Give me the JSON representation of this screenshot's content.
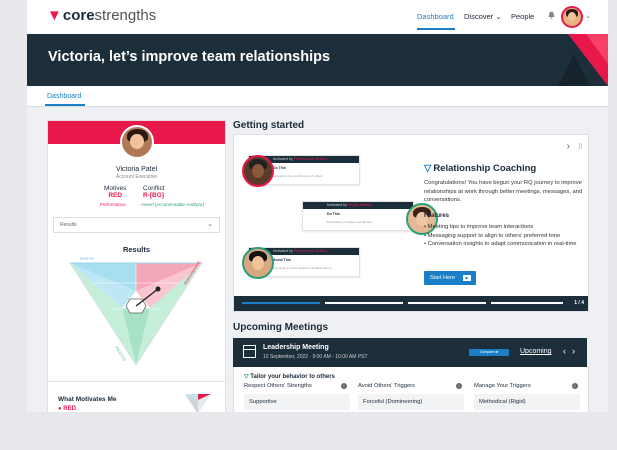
{
  "brand": {
    "logo_bold": "core",
    "logo_thin": "strengths",
    "accent": "#e8194a",
    "blue": "#1a7fc7",
    "navy": "#1d2e3b"
  },
  "nav": {
    "dashboard": "Dashboard",
    "discover": "Discover ⌄",
    "people": "People",
    "bell_icon": "bell-icon",
    "menu_chevron": "⌄"
  },
  "banner": {
    "title": "Victoria, let’s improve team relationships"
  },
  "subtabs": {
    "dashboard": "Dashboard"
  },
  "profile": {
    "name": "Victoria Patel",
    "role": "Account Executive",
    "motives_label": "Motives",
    "motives_value": "RED",
    "conflict_label": "Conflict",
    "conflict_value": "R-[BG]",
    "motives_sub": "Performance",
    "conflict_sub": "Assert [Accommodate-Analyze]",
    "results_select": "Results",
    "results_title": "Results",
    "people_label": "PEOPLE",
    "performance_label": "PERFORMANCE",
    "process_label": "PROCESS",
    "what_motivates_title": "What Motivates Me",
    "what_motivates_value": "● RED"
  },
  "getting_started": {
    "title": "Getting started",
    "nav_next": "›",
    "more_icon": "⠿",
    "cards": [
      {
        "header_pre": "Motivated by",
        "header_val": "Performance Motives",
        "title": "Do This",
        "text": "Recognize the contributions of others"
      },
      {
        "header_pre": "Motivated by",
        "header_val": "People Motives",
        "title": "Do This",
        "text": "Emphasize principles and fairness"
      },
      {
        "header_pre": "Motivated by",
        "header_val": "Performance Motives",
        "title": "Avoid This",
        "text": "Focusing on minor details or detailed issues"
      }
    ],
    "coaching_title": "Relationship Coaching",
    "coaching_desc": "Congratulations! You have begun your RQ journey to improve relationships at work through better meetings, messages, and conversations.",
    "features_label": "Features",
    "features": [
      "Meeting tips to improve team interactions",
      "Messaging support to align to others’ preferred tone",
      "Conversation insights to adapt communication in real-time"
    ],
    "start_button": "Start Here",
    "progress_text": "1 / 4",
    "progress_current": 1,
    "progress_total": 4
  },
  "upcoming": {
    "title": "Upcoming Meetings",
    "meeting_name": "Leadership Meeting",
    "meeting_time": "10 September, 2022 · 9:00 AM - 10:00 AM PST",
    "compare_label": "Compare  ⇄",
    "link_label": "Upcoming",
    "prev": "‹",
    "next": "›",
    "tailor_title": "Tailor your behavior to others",
    "columns": [
      {
        "header": "Respect Others' Strengths",
        "value": "Supportive"
      },
      {
        "header": "Avoid Others' Triggers",
        "value": "Forceful (Domineering)"
      },
      {
        "header": "Manage Your Triggers",
        "value": "Methodical (Rigid)"
      }
    ]
  }
}
